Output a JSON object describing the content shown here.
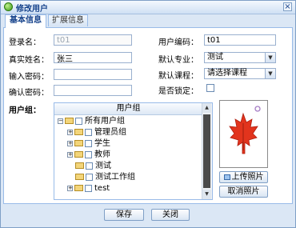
{
  "window": {
    "title": "修改用户",
    "close_glyph": "×"
  },
  "tabs": [
    {
      "label": "基本信息"
    },
    {
      "label": "扩展信息"
    }
  ],
  "form": {
    "login_name": {
      "label": "登录名：",
      "value": "t01"
    },
    "real_name": {
      "label": "真实姓名：",
      "value": "张三"
    },
    "password": {
      "label": "输入密码：",
      "value": ""
    },
    "confirm_password": {
      "label": "确认密码：",
      "value": ""
    },
    "user_code": {
      "label": "用户编码：",
      "value": "t01"
    },
    "default_major": {
      "label": "默认专业：",
      "value": "测试"
    },
    "default_course": {
      "label": "默认课程：",
      "value": "请选择课程"
    },
    "locked": {
      "label": "是否锁定：",
      "checked": false
    },
    "user_group_label": "用户组："
  },
  "group_grid": {
    "header": "用户组",
    "root": "所有用户组",
    "items": [
      "管理员组",
      "学生",
      "教师",
      "测试",
      "测试工作组",
      "test"
    ]
  },
  "photo": {
    "upload_label": "上传照片",
    "cancel_label": "取消照片"
  },
  "footer": {
    "save_label": "保存",
    "close_label": "关闭"
  },
  "colors": {
    "title_text": "#15428b",
    "border": "#99bbe8",
    "window_bg": "#dbe7f5"
  }
}
